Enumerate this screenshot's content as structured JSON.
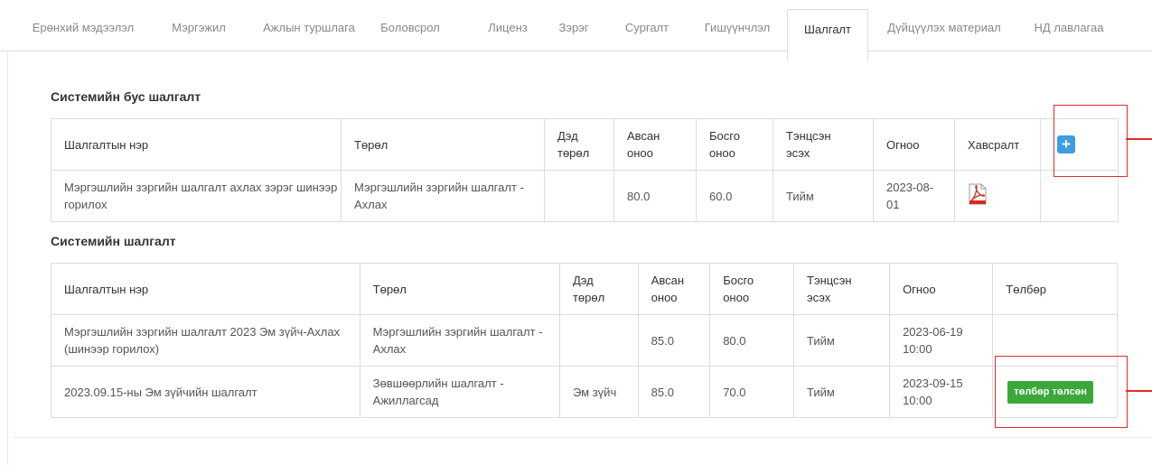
{
  "tabs": [
    {
      "label": "Ерөнхий мэдээлэл"
    },
    {
      "label": "Мэргэжил"
    },
    {
      "label": "Ажлын туршлага"
    },
    {
      "label": "Боловсрол"
    },
    {
      "label": "Лиценз"
    },
    {
      "label": "Зэрэг"
    },
    {
      "label": "Сургалт"
    },
    {
      "label": "Гишүүнчлэл"
    },
    {
      "label": "Шалгалт"
    },
    {
      "label": "Дүйцүүлэх материал"
    },
    {
      "label": "НД лавлагаа"
    }
  ],
  "active_tab": "Шалгалт",
  "non_system_exam": {
    "title": "Системийн бус шалгалт",
    "headers": {
      "name": "Шалгалтын нэр",
      "type": "Төрөл",
      "subtype_1": "Дэд",
      "subtype_2": "төрөл",
      "score_1": "Авсан",
      "score_2": "оноо",
      "threshold_1": "Босго",
      "threshold_2": "оноо",
      "passed_1": "Тэнцсэн",
      "passed_2": "эсэх",
      "date": "Огноо",
      "attachment": "Хавсралт",
      "add_icon": "+"
    },
    "rows": [
      {
        "name": "Мэргэшлийн зэргийн шалгалт ахлах зэрэг шинээр горилох",
        "type": "Мэргэшлийн зэргийн шалгалт - Ахлах",
        "subtype": "",
        "score": "80.0",
        "threshold": "60.0",
        "passed": "Тийм",
        "date": "2023-08-01",
        "attachment_icon": "pdf-icon"
      }
    ]
  },
  "system_exam": {
    "title": "Системийн шалгалт",
    "headers": {
      "name": "Шалгалтын нэр",
      "type": "Төрөл",
      "subtype_1": "Дэд",
      "subtype_2": "төрөл",
      "score_1": "Авсан",
      "score_2": "оноо",
      "threshold_1": "Босго",
      "threshold_2": "оноо",
      "passed_1": "Тэнцсэн",
      "passed_2": "эсэх",
      "date": "Огноо",
      "payment": "Төлбөр"
    },
    "rows": [
      {
        "name": "Мэргэшлийн зэргийн шалгалт 2023 Эм зүйч-Ахлах (шинээр горилох)",
        "type": "Мэргэшлийн зэргийн шалгалт - Ахлах",
        "subtype": "",
        "score": "85.0",
        "threshold": "80.0",
        "passed": "Тийм",
        "date": "2023-06-19 10:00",
        "payment": ""
      },
      {
        "name": "2023.09.15-ны Эм зүйчийн шалгалт",
        "type": "Зөвшөөрлийн шалгалт - Ажиллагсад",
        "subtype": "Эм зүйч",
        "score": "85.0",
        "threshold": "70.0",
        "passed": "Тийм",
        "date": "2023-09-15 10:00",
        "payment": "төлбөр төлсөн"
      }
    ]
  },
  "colors": {
    "accent_blue": "#3d9de0",
    "paid_green": "#3aa93a",
    "annotation_red": "#e32a2a"
  }
}
